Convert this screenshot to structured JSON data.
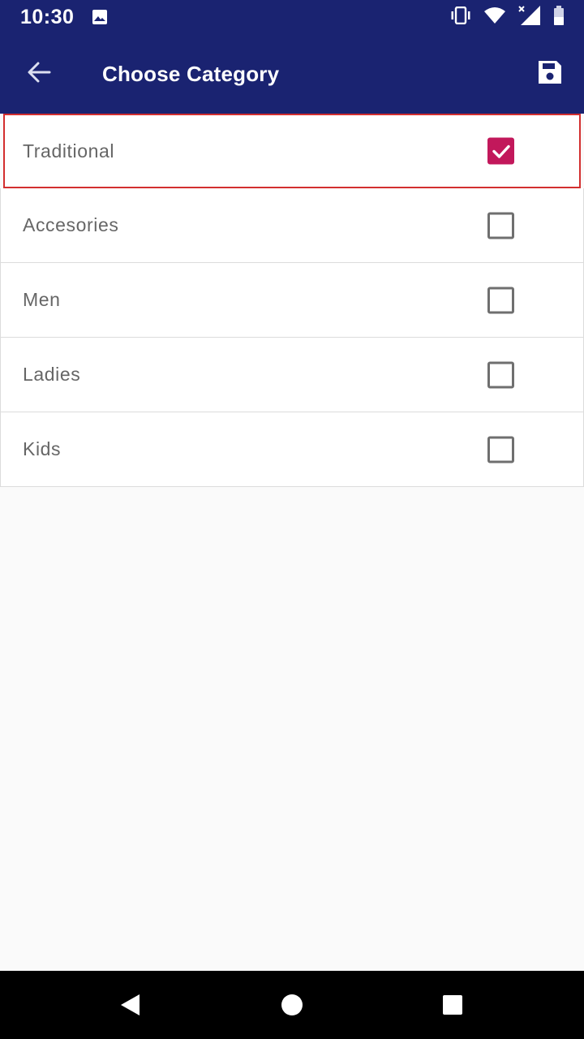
{
  "status_bar": {
    "time": "10:30",
    "icons": [
      "image-icon",
      "vibrate-icon",
      "wifi-icon",
      "signal-icon",
      "battery-icon"
    ]
  },
  "app_bar": {
    "title": "Choose Category",
    "back_icon": "arrow-back-icon",
    "save_icon": "save-icon"
  },
  "categories": [
    {
      "label": "Traditional",
      "checked": true
    },
    {
      "label": "Accesories",
      "checked": false
    },
    {
      "label": "Men",
      "checked": false
    },
    {
      "label": "Ladies",
      "checked": false
    },
    {
      "label": "Kids",
      "checked": false
    }
  ],
  "nav_bar": {
    "icons": [
      "back-triangle-icon",
      "home-circle-icon",
      "recents-square-icon"
    ]
  },
  "colors": {
    "app_bar": "#1a2371",
    "checkbox_checked": "#c2185b",
    "highlight_border": "#d32f2f",
    "background": "#fafafa"
  }
}
